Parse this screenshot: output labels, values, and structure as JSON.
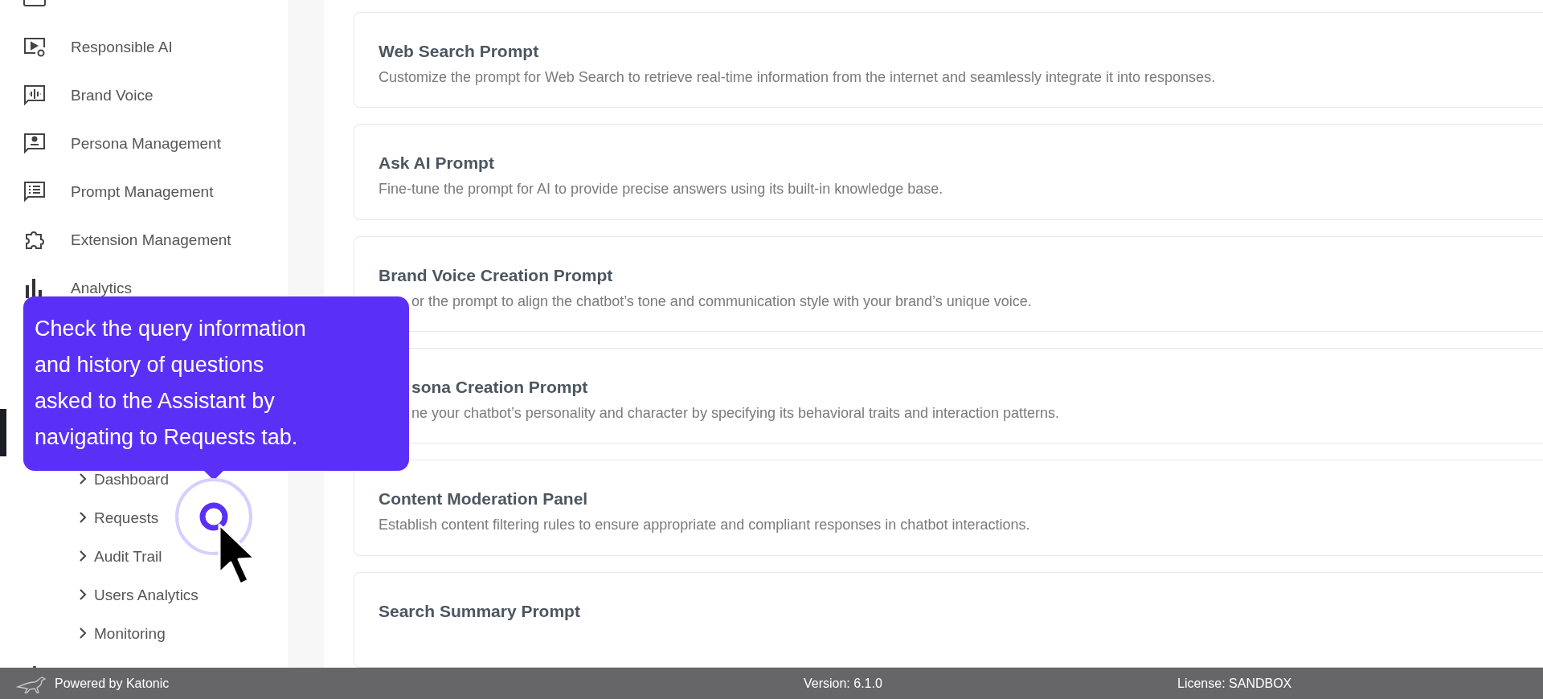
{
  "sidebar": {
    "items": [
      {
        "label": "Responsible AI"
      },
      {
        "label": "Brand Voice"
      },
      {
        "label": "Persona Management"
      },
      {
        "label": "Prompt Management"
      },
      {
        "label": "Extension Management"
      },
      {
        "label": "Analytics"
      }
    ],
    "submenu": {
      "expanded": true,
      "items": [
        {
          "label": "Dashboard"
        },
        {
          "label": "Requests"
        },
        {
          "label": "Audit Trail"
        },
        {
          "label": "Users Analytics"
        },
        {
          "label": "Monitoring"
        }
      ]
    }
  },
  "cards": [
    {
      "title": "Web Search Prompt",
      "description": "Customize the prompt for Web Search to retrieve real-time information from the internet and seamlessly integrate it into responses."
    },
    {
      "title": "Ask AI Prompt",
      "description": "Fine-tune the prompt for AI to provide precise answers using its built-in knowledge base."
    },
    {
      "title": "Brand Voice Creation Prompt",
      "description": "or the prompt to align the chatbot’s tone and communication style with your brand’s unique voice."
    },
    {
      "title": "sona Creation Prompt",
      "description": "ne your chatbot’s personality and character by specifying its behavioral traits and interaction patterns."
    },
    {
      "title": "Content Moderation Panel",
      "description": "Establish content filtering rules to ensure appropriate and compliant responses in chatbot interactions."
    },
    {
      "title": "Search Summary Prompt"
    }
  ],
  "tooltip": {
    "lines": [
      "Check the query information",
      "and history of questions",
      "asked to the Assistant by",
      "navigating to Requests tab."
    ]
  },
  "footer": {
    "powered_by": "Powered by Katonic",
    "version": "Version: 6.1.0",
    "license": "License: SANDBOX"
  }
}
